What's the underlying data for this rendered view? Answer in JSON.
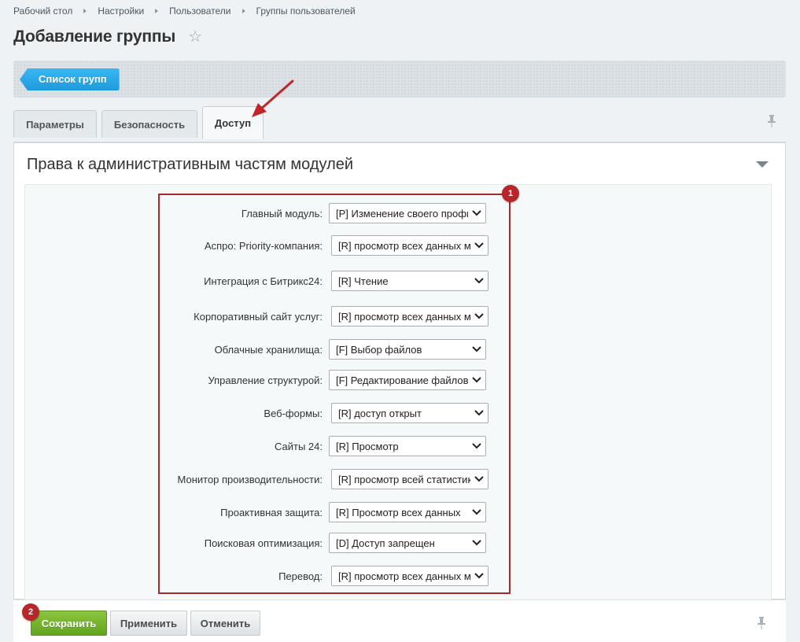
{
  "breadcrumb": [
    "Рабочий стол",
    "Настройки",
    "Пользователи",
    "Группы пользователей"
  ],
  "page_title": "Добавление группы",
  "toolbar": {
    "list_button": "Список групп"
  },
  "tabs": [
    {
      "label": "Параметры",
      "active": false
    },
    {
      "label": "Безопасность",
      "active": false
    },
    {
      "label": "Доступ",
      "active": true
    }
  ],
  "section": {
    "title": "Права к административным частям модулей"
  },
  "badges": {
    "first": "1",
    "second": "2"
  },
  "rights": [
    {
      "label": "Главный модуль:",
      "value": "[P] Изменение своего профиля"
    },
    {
      "label": "Аспро: Priority-компания:",
      "value": "[R] просмотр всех данных модуля"
    },
    {
      "label": "Интеграция с Битрикс24:",
      "value": "[R] Чтение"
    },
    {
      "label": "Корпоративный сайт услуг:",
      "value": "[R] просмотр всех данных модуля"
    },
    {
      "label": "Облачные хранилища:",
      "value": "[F] Выбор файлов"
    },
    {
      "label": "Управление структурой:",
      "value": "[F] Редактирование файлов"
    },
    {
      "label": "Веб-формы:",
      "value": "[R] доступ открыт"
    },
    {
      "label": "Сайты 24:",
      "value": "[R] Просмотр"
    },
    {
      "label": "Монитор производительности:",
      "value": "[R] просмотр всей статистики"
    },
    {
      "label": "Проактивная защита:",
      "value": "[R] Просмотр всех данных"
    },
    {
      "label": "Поисковая оптимизация:",
      "value": "[D] Доступ запрещен"
    },
    {
      "label": "Перевод:",
      "value": "[R] просмотр всех данных модуля"
    }
  ],
  "footer": {
    "save": "Сохранить",
    "apply": "Применить",
    "cancel": "Отменить"
  },
  "icons": {
    "star": "star-icon",
    "pin": "pin-icon",
    "collapse": "chevron-down-icon",
    "select_arrow": "chevron-down-icon"
  },
  "colors": {
    "highlight": "#a82a2a",
    "badge": "#b8262a",
    "save": "#6aab25",
    "list_button": "#26a5e6"
  }
}
